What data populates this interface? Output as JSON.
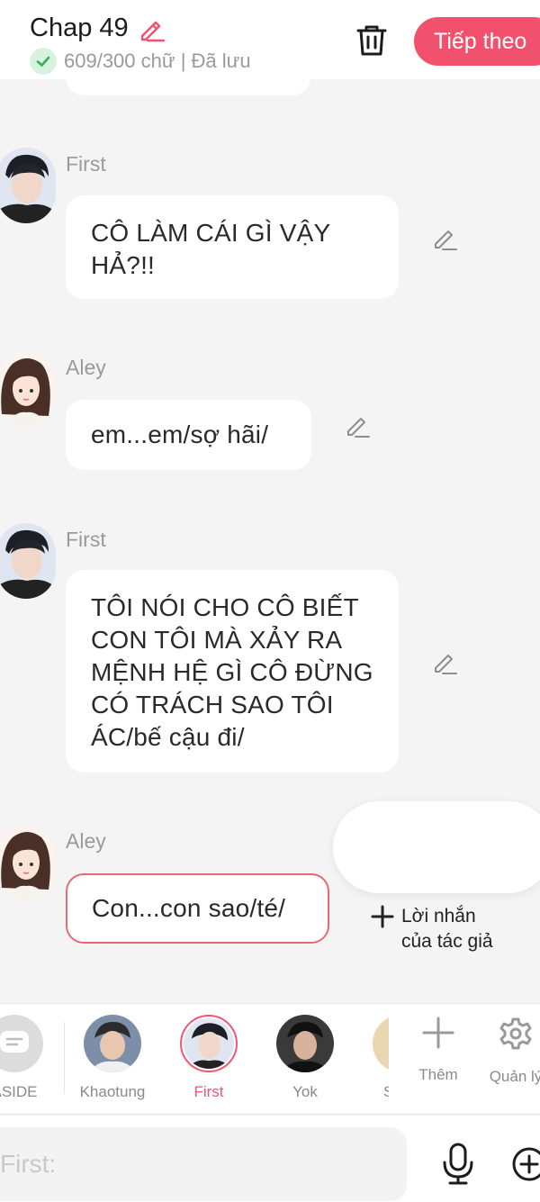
{
  "header": {
    "title": "Chap 49",
    "status": "609/300 chữ | Đã lưu",
    "next_label": "Tiếp theo",
    "accent": "#f2516e"
  },
  "messages": [
    {
      "speaker": "First",
      "text": "CÔ LÀM CÁI GÌ VẬY HẢ?!!"
    },
    {
      "speaker": "Aley",
      "text": "em...em/sợ hãi/"
    },
    {
      "speaker": "First",
      "text": "TÔI NÓI CHO CÔ BIẾT CON TÔI MÀ XẢY RA MỆNH HỆ GÌ CÔ ĐỪNG CÓ TRÁCH SAO TÔI ÁC/bế cậu đi/"
    },
    {
      "speaker": "Aley",
      "text": "Con...con sao/té/"
    }
  ],
  "author_note": {
    "line1": "Lời nhắn",
    "line2": "của tác giả"
  },
  "characters": [
    {
      "name": "ASIDE"
    },
    {
      "name": "Khaotung"
    },
    {
      "name": "First"
    },
    {
      "name": "Yok"
    },
    {
      "name": "S"
    }
  ],
  "tools": {
    "add_label": "Thêm",
    "manage_label": "Quản lý"
  },
  "composer": {
    "placeholder": "First:"
  }
}
